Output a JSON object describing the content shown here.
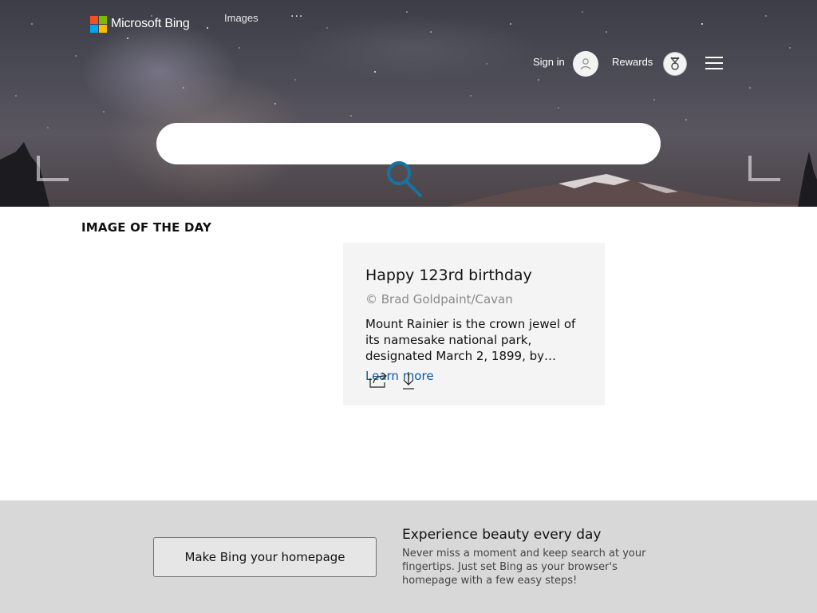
{
  "header": {
    "logo_text": "Microsoft Bing",
    "logo_colors": [
      "#f25022",
      "#7fba00",
      "#00a4ef",
      "#ffb900"
    ],
    "nav_images": "Images",
    "nav_more": "···",
    "sign_in": "Sign in",
    "rewards": "Rewards",
    "icons": [
      "user-icon",
      "medal-icon",
      "hamburger-icon"
    ]
  },
  "search": {
    "placeholder": "",
    "icon": "search-icon",
    "icon_color": "#1573a5"
  },
  "iotd": {
    "heading": "IMAGE OF THE DAY",
    "title": "Happy 123rd birthday",
    "credit": "© Brad Goldpaint/Cavan",
    "description": "Mount Rainier is the crown jewel of its namesake national park, designated March 2, 1899, by…",
    "learn_more": "Learn more",
    "actions": [
      "share-icon",
      "download-icon"
    ]
  },
  "promo": {
    "button": "Make Bing your homepage",
    "title": "Experience beauty every day",
    "text": "Never miss a moment and keep search at your fingertips. Just set Bing as your browser's homepage with a few easy steps!"
  }
}
